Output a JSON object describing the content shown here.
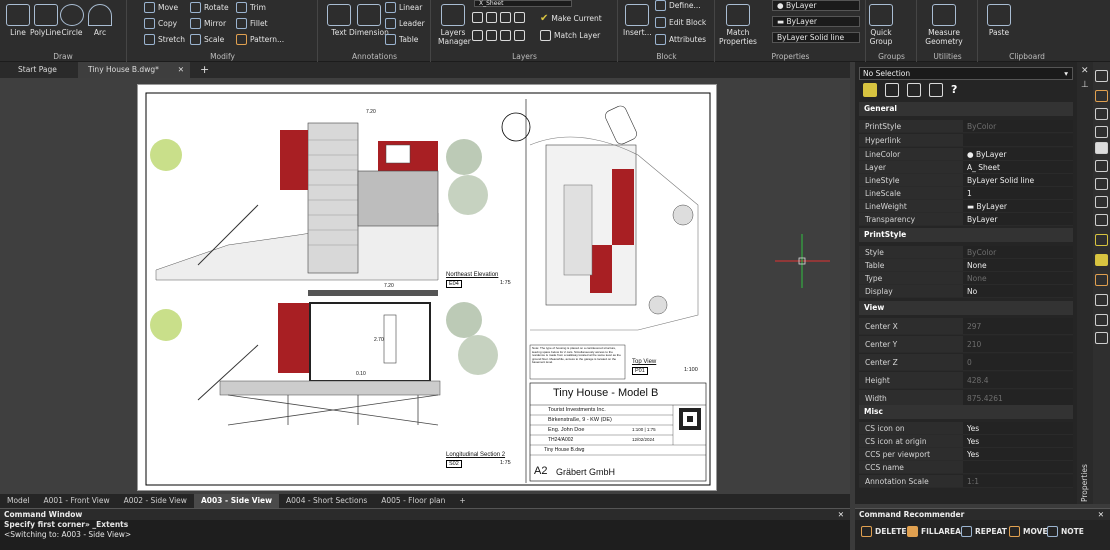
{
  "ribbon": {
    "draw": {
      "line": "Line",
      "polyline": "PolyLine",
      "circle": "Circle",
      "arc": "Arc",
      "group": "Draw"
    },
    "modify": {
      "move": "Move",
      "rotate": "Rotate",
      "trim": "Trim",
      "copy": "Copy",
      "mirror": "Mirror",
      "fillet": "Fillet",
      "stretch": "Stretch",
      "scale": "Scale",
      "pattern": "Pattern...",
      "group": "Modify"
    },
    "annotations": {
      "text": "Text",
      "dimension": "Dimension",
      "linear": "Linear",
      "leader": "Leader",
      "table": "Table",
      "group": "Annotations"
    },
    "layers": {
      "manager": "Layers Manager",
      "current_layer": "X_Sheet",
      "make_current": "Make Current",
      "match_layer": "Match Layer",
      "group": "Layers"
    },
    "block": {
      "insert": "Insert...",
      "define": "Define...",
      "edit_block": "Edit Block",
      "attributes": "Attributes",
      "group": "Block"
    },
    "properties": {
      "match": "Match Properties",
      "color": "ByLayer",
      "lineweight": "ByLayer",
      "linetype_a": "ByLayer",
      "linetype_b": "Solid line",
      "group": "Properties"
    },
    "groups": {
      "quick_group": "Quick Group",
      "group": "Groups"
    },
    "utilities": {
      "measure": "Measure Geometry",
      "group": "Utilities"
    },
    "clipboard": {
      "paste": "Paste",
      "group": "Clipboard"
    }
  },
  "doc_tabs": {
    "start": "Start Page",
    "current": "Tiny House B.dwg*"
  },
  "drawing": {
    "ne_elevation": "Northeast Elevation",
    "ne_code": "E04",
    "ne_scale": "1:75",
    "long_section": "Longitudinal Section 2",
    "long_code": "S02",
    "long_scale": "1:75",
    "top_view": "Top View",
    "top_code": "P01",
    "top_scale": "1:100",
    "dim_top": "7.20",
    "dim_mid": "7.20",
    "dim_270": "2.70",
    "dim_010": "0.10",
    "title": "Tiny House - Model B",
    "client": "Tourist Investments Inc.",
    "address": "Birkenstraße, 9 - KW (DE)",
    "technician": "Eng. John Doe",
    "sheet": "TH24/A002",
    "scale": "1:100 | 1:75",
    "date": "12/02/2024",
    "file": "Tiny House B.dwg",
    "sheet_size": "A2",
    "company": "Gräbert GmbH",
    "note": "Note: The type of housing is placed on a cantilevered structure, leaving space below for 2 cars. Simultaneously access to the residence is made from a walkway located at the same level as the ground floor. Meanwhile, access to the garage is located on the basement level."
  },
  "layout_tabs": [
    "Model",
    "A001 - Front View",
    "A002 - Side View",
    "A003 - Side View",
    "A004 - Short Sections",
    "A005 - Floor plan",
    "+"
  ],
  "active_layout": "A003 - Side View",
  "command": {
    "title": "Command Window",
    "line1": "Specify first corner» _Extents",
    "line2": "",
    "line3": "<Switching to: A003 - Side View>"
  },
  "props": {
    "selection": "No Selection",
    "general": "General",
    "printstyle_k": "PrintStyle",
    "printstyle_v": "ByColor",
    "hyperlink_k": "Hyperlink",
    "hyperlink_v": "",
    "linecolor_k": "LineColor",
    "linecolor_v": "ByLayer",
    "layer_k": "Layer",
    "layer_v": "A_ Sheet",
    "linetype_k": "LineStyle",
    "linetype_v": "ByLayer    Solid line",
    "linescale_k": "LineScale",
    "linescale_v": "1",
    "lineweight_k": "LineWeight",
    "lineweight_v": "ByLayer",
    "transp_k": "Transparency",
    "transp_v": "ByLayer",
    "ps_section": "PrintStyle",
    "style_k": "Style",
    "style_v": "ByColor",
    "table_k": "Table",
    "table_v": "None",
    "type_k": "Type",
    "type_v": "None",
    "display_k": "Display",
    "display_v": "No",
    "view": "View",
    "cx_k": "Center X",
    "cx_v": "297",
    "cy_k": "Center Y",
    "cy_v": "210",
    "cz_k": "Center Z",
    "cz_v": "0",
    "h_k": "Height",
    "h_v": "428.4",
    "w_k": "Width",
    "w_v": "875.4261",
    "misc": "Misc",
    "cs1_k": "CS icon on",
    "cs1_v": "Yes",
    "cs2_k": "CS icon at origin",
    "cs2_v": "Yes",
    "cs3_k": "CCS per viewport",
    "cs3_v": "Yes",
    "ccsn_k": "CCS name",
    "ccsn_v": "",
    "annot_k": "Annotation Scale",
    "annot_v": "1:1",
    "panel_label": "Properties"
  },
  "recommender": {
    "title": "Command Recommender",
    "items": [
      "DELETE",
      "FILLAREA",
      "REPEAT",
      "MOVE",
      "NOTE"
    ]
  },
  "colors": {
    "accent": "#a81f23",
    "layer_yellow": "#d8c440",
    "crosshair_red": "#e03030",
    "crosshair_green": "#30c040"
  }
}
